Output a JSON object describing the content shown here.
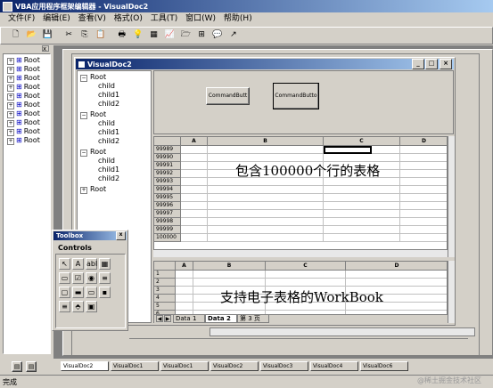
{
  "app": {
    "title": "VBA应用程序框架编辑器 - VisualDoc2",
    "window_buttons": [
      "_",
      "□",
      "×"
    ]
  },
  "menu": [
    "文件(F)",
    "编辑(E)",
    "查看(V)",
    "格式(O)",
    "工具(T)",
    "窗口(W)",
    "帮助(H)"
  ],
  "sidebar": {
    "items": [
      "Root",
      "Root",
      "Root",
      "Root",
      "Root",
      "Root",
      "Root",
      "Root",
      "Root",
      "Root"
    ]
  },
  "doc": {
    "title": "VisualDoc2",
    "tree": [
      {
        "label": "Root",
        "expander": "−"
      },
      {
        "label": "child"
      },
      {
        "label": "child1"
      },
      {
        "label": "child2"
      },
      {
        "label": "Root",
        "expander": "−"
      },
      {
        "label": "child"
      },
      {
        "label": "child1"
      },
      {
        "label": "child2"
      },
      {
        "label": "Root",
        "expander": "−"
      },
      {
        "label": "child"
      },
      {
        "label": "child1"
      },
      {
        "label": "child2"
      },
      {
        "label": "Root",
        "expander": "+"
      }
    ],
    "buttons": [
      "CommandButt",
      "CommandButto"
    ],
    "grid": {
      "columns": [
        "A",
        "B",
        "C",
        "D"
      ],
      "rows": [
        "99989",
        "99990",
        "99991",
        "99992",
        "99993",
        "99994",
        "99995",
        "99996",
        "99997",
        "99998",
        "99999",
        "100000"
      ],
      "overlay": "包含100000个行的表格"
    },
    "workbook": {
      "columns": [
        "A",
        "B",
        "C",
        "D",
        "E"
      ],
      "rows": [
        "1",
        "2",
        "3",
        "4",
        "5",
        "6"
      ],
      "overlay": "支持电子表格的WorkBook",
      "tabs": [
        "Data 1",
        "Data 2",
        "第 3 页"
      ]
    }
  },
  "toolbox": {
    "title": "Toolbox",
    "tab": "Controls",
    "tools": [
      "↖",
      "A",
      "abl",
      "▦",
      "▭",
      "☑",
      "◉",
      "≡",
      "▢",
      "▬",
      "▭",
      "▪",
      "≡",
      "⬘",
      "▣"
    ]
  },
  "taskbar": [
    "VisualDoc2",
    "VisualDoc1",
    "VisualDoc1",
    "VisualDoc2",
    "VisualDoc3",
    "VisualDoc4",
    "VisualDoc6"
  ],
  "status": "完成",
  "watermark": "@稀土掘金技术社区"
}
